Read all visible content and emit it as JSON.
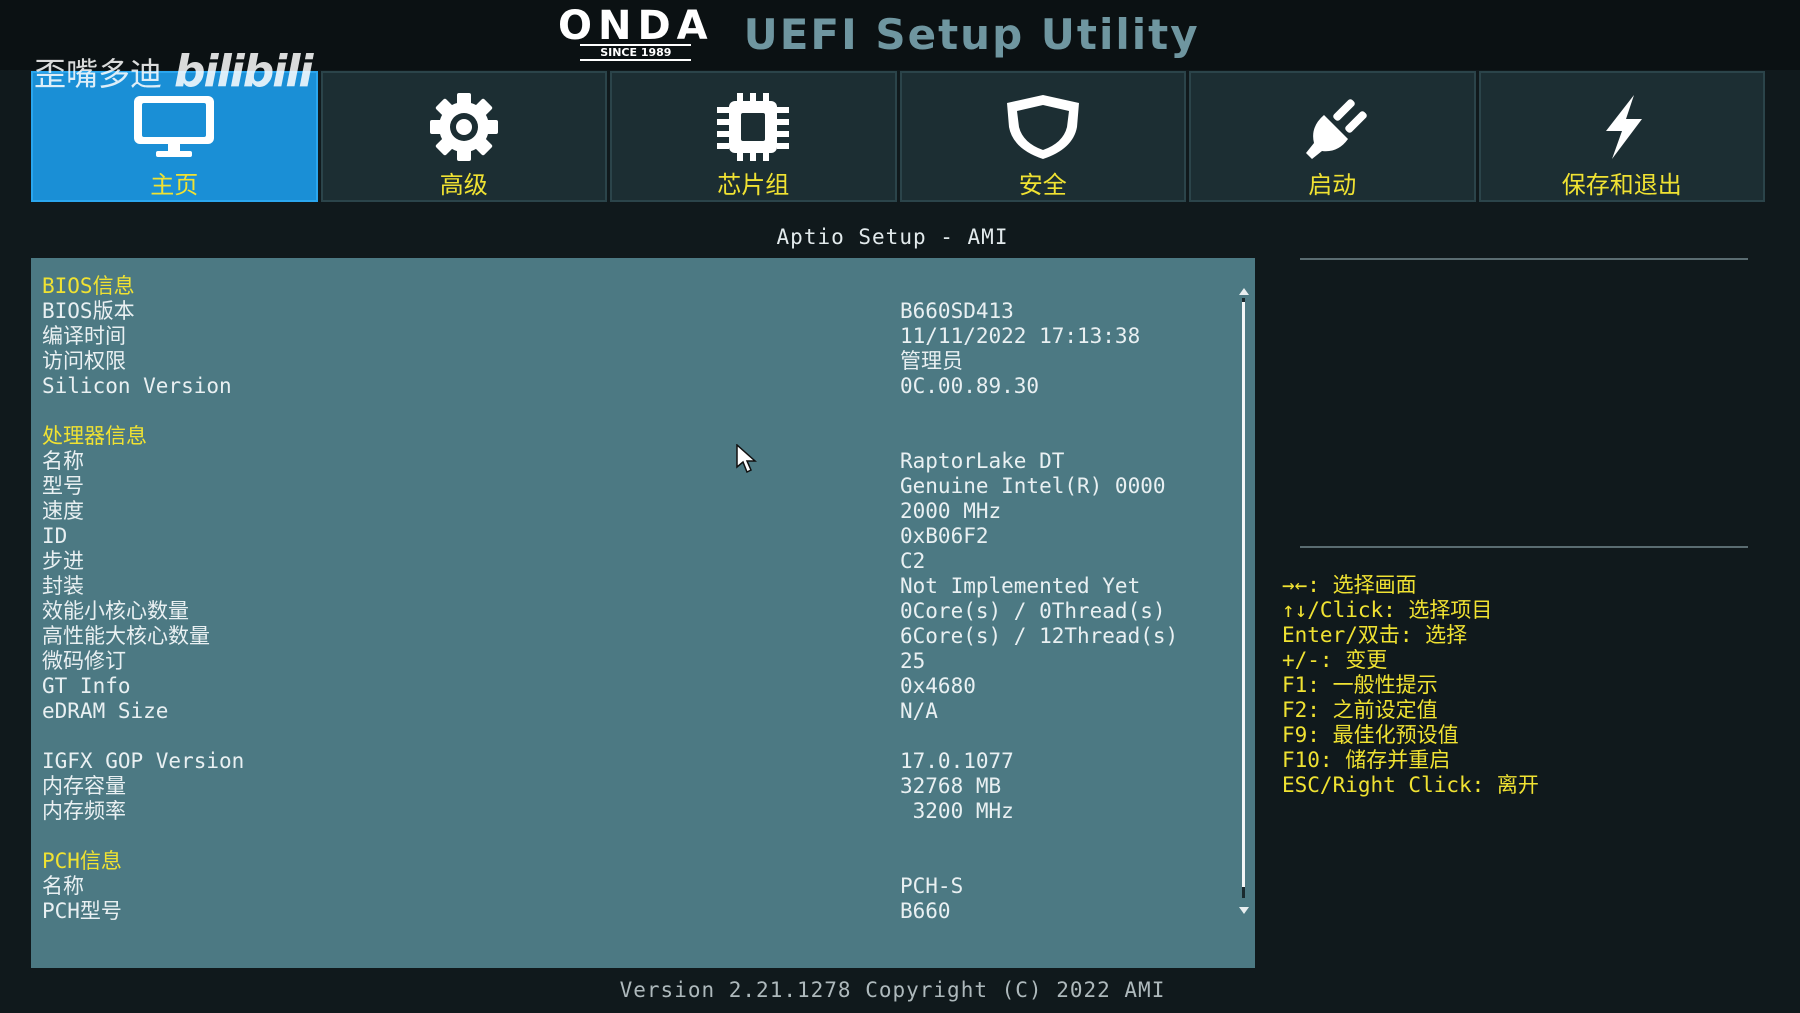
{
  "header": {
    "brand_word": "ONDA",
    "brand_since": "SINCE 1989",
    "title": "UEFI Setup Utility"
  },
  "watermark": {
    "name": "歪嘴多迪",
    "site": "bilibili"
  },
  "tabs": [
    {
      "label": "主页",
      "icon": "monitor-icon",
      "active": true
    },
    {
      "label": "高级",
      "icon": "gear-icon",
      "active": false
    },
    {
      "label": "芯片组",
      "icon": "chip-icon",
      "active": false
    },
    {
      "label": "安全",
      "icon": "shield-icon",
      "active": false
    },
    {
      "label": "启动",
      "icon": "power-plug-icon",
      "active": false
    },
    {
      "label": "保存和退出",
      "icon": "lightning-icon",
      "active": false
    }
  ],
  "subtitle": "Aptio Setup - AMI",
  "info": {
    "bios_header": "BIOS信息",
    "bios_version_label": "BIOS版本",
    "bios_version_value": "B660SD413",
    "build_time_label": "编译时间",
    "build_time_value": "11/11/2022 17:13:38",
    "access_label": "访问权限",
    "access_value": "管理员",
    "silicon_label": "Silicon Version",
    "silicon_value": "0C.00.89.30",
    "cpu_header": "处理器信息",
    "cpu_name_label": "名称",
    "cpu_name_value": "RaptorLake DT",
    "cpu_model_label": "型号",
    "cpu_model_value": "Genuine Intel(R) 0000",
    "cpu_speed_label": "速度",
    "cpu_speed_value": "2000 MHz",
    "cpu_id_label": "ID",
    "cpu_id_value": "0xB06F2",
    "cpu_stepping_label": "步进",
    "cpu_stepping_value": "C2",
    "cpu_package_label": "封装",
    "cpu_package_value": "Not Implemented Yet",
    "ecores_label": "效能小核心数量",
    "ecores_value": "0Core(s) / 0Thread(s)",
    "pcores_label": "高性能大核心数量",
    "pcores_value": "6Core(s) / 12Thread(s)",
    "microcode_label": "微码修订",
    "microcode_value": "25",
    "gt_label": "GT Info",
    "gt_value": "0x4680",
    "edram_label": "eDRAM Size",
    "edram_value": "N/A",
    "igfx_label": "IGFX GOP Version",
    "igfx_value": "17.0.1077",
    "mem_size_label": "内存容量",
    "mem_size_value": "32768 MB",
    "mem_freq_label": "内存频率",
    "mem_freq_value": " 3200 MHz",
    "pch_header": "PCH信息",
    "pch_name_label": "名称",
    "pch_name_value": "PCH-S",
    "pch_model_label": "PCH型号",
    "pch_model_value": "B660"
  },
  "help": [
    "→←: 选择画面",
    "↑↓/Click: 选择项目",
    "Enter/双击: 选择",
    "+/-: 变更",
    "F1: 一般性提示",
    "F2: 之前设定值",
    "F9: 最佳化预设值",
    "F10: 储存并重启",
    "ESC/Right Click: 离开"
  ],
  "footer": "Version 2.21.1278 Copyright (C) 2022 AMI",
  "colors": {
    "active_tab": "#1a8fd6",
    "tab_bg": "#1c2e33",
    "panel_bg": "#4c7983",
    "highlight_text": "#f0e232",
    "title_text": "#6f96a0"
  }
}
